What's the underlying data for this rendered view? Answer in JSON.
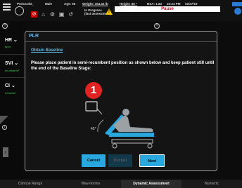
{
  "header": {
    "protocol": "ProtocolG_",
    "sex": "Male",
    "age": "Age: 56",
    "weight": "Weight: 154.32 lb",
    "height": "Height: 68 \"",
    "bsa": "BSA: 1.83",
    "time": "10:24 PM",
    "date": "02/27/19",
    "status_line1": "In Progress",
    "status_line2": "(last assessment)",
    "warning_glyph": "!",
    "pause_label": "Pause"
  },
  "sidebar": {
    "params": [
      {
        "label": "HR ⌄",
        "unit": "bpm"
      },
      {
        "label": "SVI ⌄",
        "unit": "mL/beat/m²"
      },
      {
        "label": "CI ⌄",
        "unit": "L/min/m²"
      }
    ],
    "arrow": "›"
  },
  "modal": {
    "title": "PLR",
    "link": "Obtain Baseline",
    "instruction": "Please place patient in semi-recumbent position as shown below and keep patient still until the end of the Baseline Stage:",
    "step_number": "1",
    "angle_label": "45°",
    "buttons": {
      "cancel": "Cancel",
      "restart": "Restart",
      "next": "Next"
    }
  },
  "bottom_tabs": [
    {
      "label": "Clinical Range",
      "active": false
    },
    {
      "label": "Waveforms",
      "active": false
    },
    {
      "label": "Dynamic Assessment",
      "active": true
    },
    {
      "label": "Numeric",
      "active": false
    }
  ],
  "colors": {
    "accent_blue": "#29a8e0",
    "alert_red": "#e32222",
    "param_green": "#3fd14f",
    "warn_yellow": "#f5c300"
  }
}
